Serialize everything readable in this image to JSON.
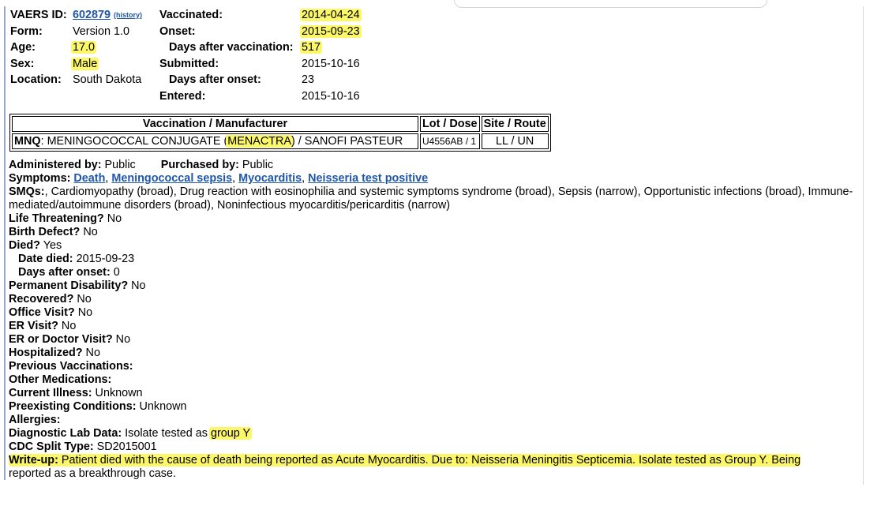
{
  "header": {
    "vaers_id_label": "VAERS ID:",
    "vaers_id": "602879",
    "history_link": "(history)",
    "form_label": "Form:",
    "form_value": "Version 1.0",
    "age_label": "Age:",
    "age_value": "17.0",
    "sex_label": "Sex:",
    "sex_value": "Male",
    "location_label": "Location:",
    "location_value": "South Dakota",
    "vaccinated_label": "Vaccinated:",
    "vaccinated_value": "2014-04-24",
    "onset_label": "Onset:",
    "onset_value": "2015-09-23",
    "days_after_vax_label": "Days after vaccination:",
    "days_after_vax_value": "517",
    "submitted_label": "Submitted:",
    "submitted_value": "2015-10-16",
    "days_after_onset_label": "Days after onset:",
    "days_after_onset_value": "23",
    "entered_label": "Entered:",
    "entered_value": "2015-10-16"
  },
  "vax_table": {
    "headers": [
      "Vaccination / Manufacturer",
      "Lot / Dose",
      "Site / Route"
    ],
    "row": {
      "code": "MNQ",
      "name_prefix": ": MENINGOCOCCAL CONJUGATE (",
      "brand": "MENACTRA",
      "name_suffix": ") / SANOFI PASTEUR",
      "lot_dose": "U4556AB / 1",
      "site_route": "LL / UN"
    }
  },
  "details": {
    "administered_label": "Administered by:",
    "administered_value": " Public",
    "purchased_label": "Purchased by:",
    "purchased_value": " Public",
    "symptoms_label": "Symptoms:",
    "symptoms": [
      "Death",
      "Meningococcal sepsis",
      "Myocarditis",
      "Neisseria test positive"
    ],
    "smqs_label": "SMQs:",
    "smqs_value": ", Cardiomyopathy (broad), Drug reaction with eosinophilia and systemic symptoms syndrome (broad), Sepsis (narrow), Opportunistic infections (broad), Immune-mediated/autoimmune disorders (broad), Noninfectious myocarditis/pericarditis (narrow)",
    "life_threatening_label": "Life Threatening?",
    "life_threatening_value": " No",
    "birth_defect_label": "Birth Defect?",
    "birth_defect_value": " No",
    "died_label": "Died?",
    "died_value": " Yes",
    "date_died_label": "Date died:",
    "date_died_value": " 2015-09-23",
    "days_after_onset_label": "Days after onset:",
    "days_after_onset_value": " 0",
    "permanent_disability_label": "Permanent Disability?",
    "permanent_disability_value": " No",
    "recovered_label": "Recovered?",
    "recovered_value": " No",
    "office_visit_label": "Office Visit?",
    "office_visit_value": " No",
    "er_visit_label": "ER Visit?",
    "er_visit_value": " No",
    "er_doctor_label": "ER or Doctor Visit?",
    "er_doctor_value": " No",
    "hospitalized_label": "Hospitalized?",
    "hospitalized_value": " No",
    "prev_vax_label": "Previous Vaccinations:",
    "other_meds_label": "Other Medications:",
    "current_illness_label": "Current Illness:",
    "current_illness_value": " Unknown",
    "preexisting_label": "Preexisting Conditions:",
    "preexisting_value": " Unknown",
    "allergies_label": "Allergies:",
    "lab_label": "Diagnostic Lab Data:",
    "lab_value_prefix": " Isolate tested as ",
    "lab_value_highlight": "group Y",
    "cdc_label": "CDC Split Type:",
    "cdc_value": " SD2015001",
    "writeup_label": "Write-up:",
    "writeup_highlight": "Patient died with the cause of death being reported as Acute Myocarditis. Due to: Neisseria Meningitis Septicemia. Isolate tested as Group Y. Being",
    "writeup_rest": "reported as a breakthrough case."
  },
  "colors": {
    "highlight": "#fbf769",
    "link": "#1f56a8"
  }
}
